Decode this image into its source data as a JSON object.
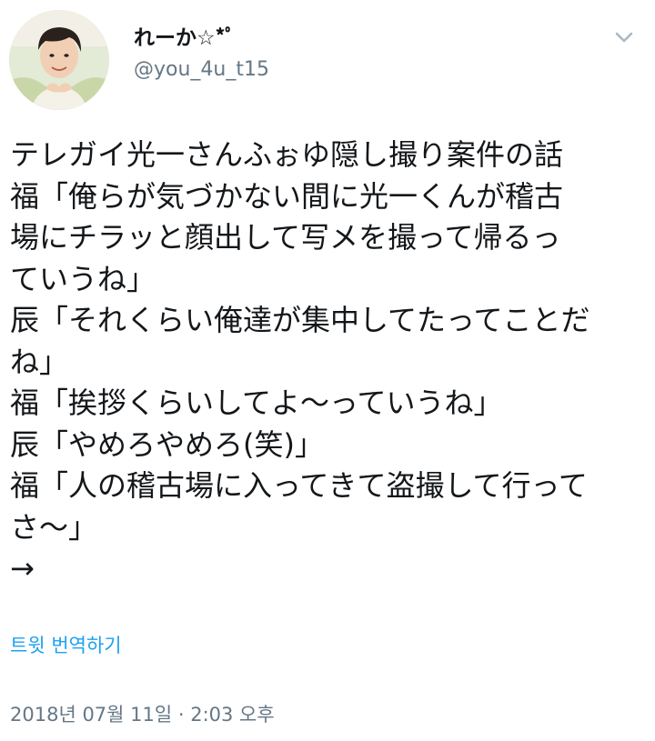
{
  "colors": {
    "text_primary": "#14171a",
    "text_secondary": "#657786",
    "link": "#1da1f2",
    "background": "#ffffff"
  },
  "user": {
    "display_name": "れーか☆*ﾟ",
    "handle": "@you_4u_t15",
    "avatar_icon": "profile-photo"
  },
  "menu": {
    "icon": "chevron-down-icon"
  },
  "tweet": {
    "lines": [
      "テレガイ光一さんふぉゆ隠し撮り案件の話",
      "福「俺らが気づかない間に光一くんが稽古",
      "場にチラッと顔出して写メを撮って帰るっ",
      "ていうね」",
      "辰「それくらい俺達が集中してたってことだ",
      "ね」",
      "福「挨拶くらいしてよ〜っていうね」",
      "辰「やめろやめろ(笑)」",
      "福「人の稽古場に入ってきて盗撮して行って",
      "さ〜」",
      "→"
    ]
  },
  "translate": {
    "label": "트윗 번역하기"
  },
  "meta": {
    "timestamp": "2018년 07월 11일 · 2:03 오후"
  }
}
